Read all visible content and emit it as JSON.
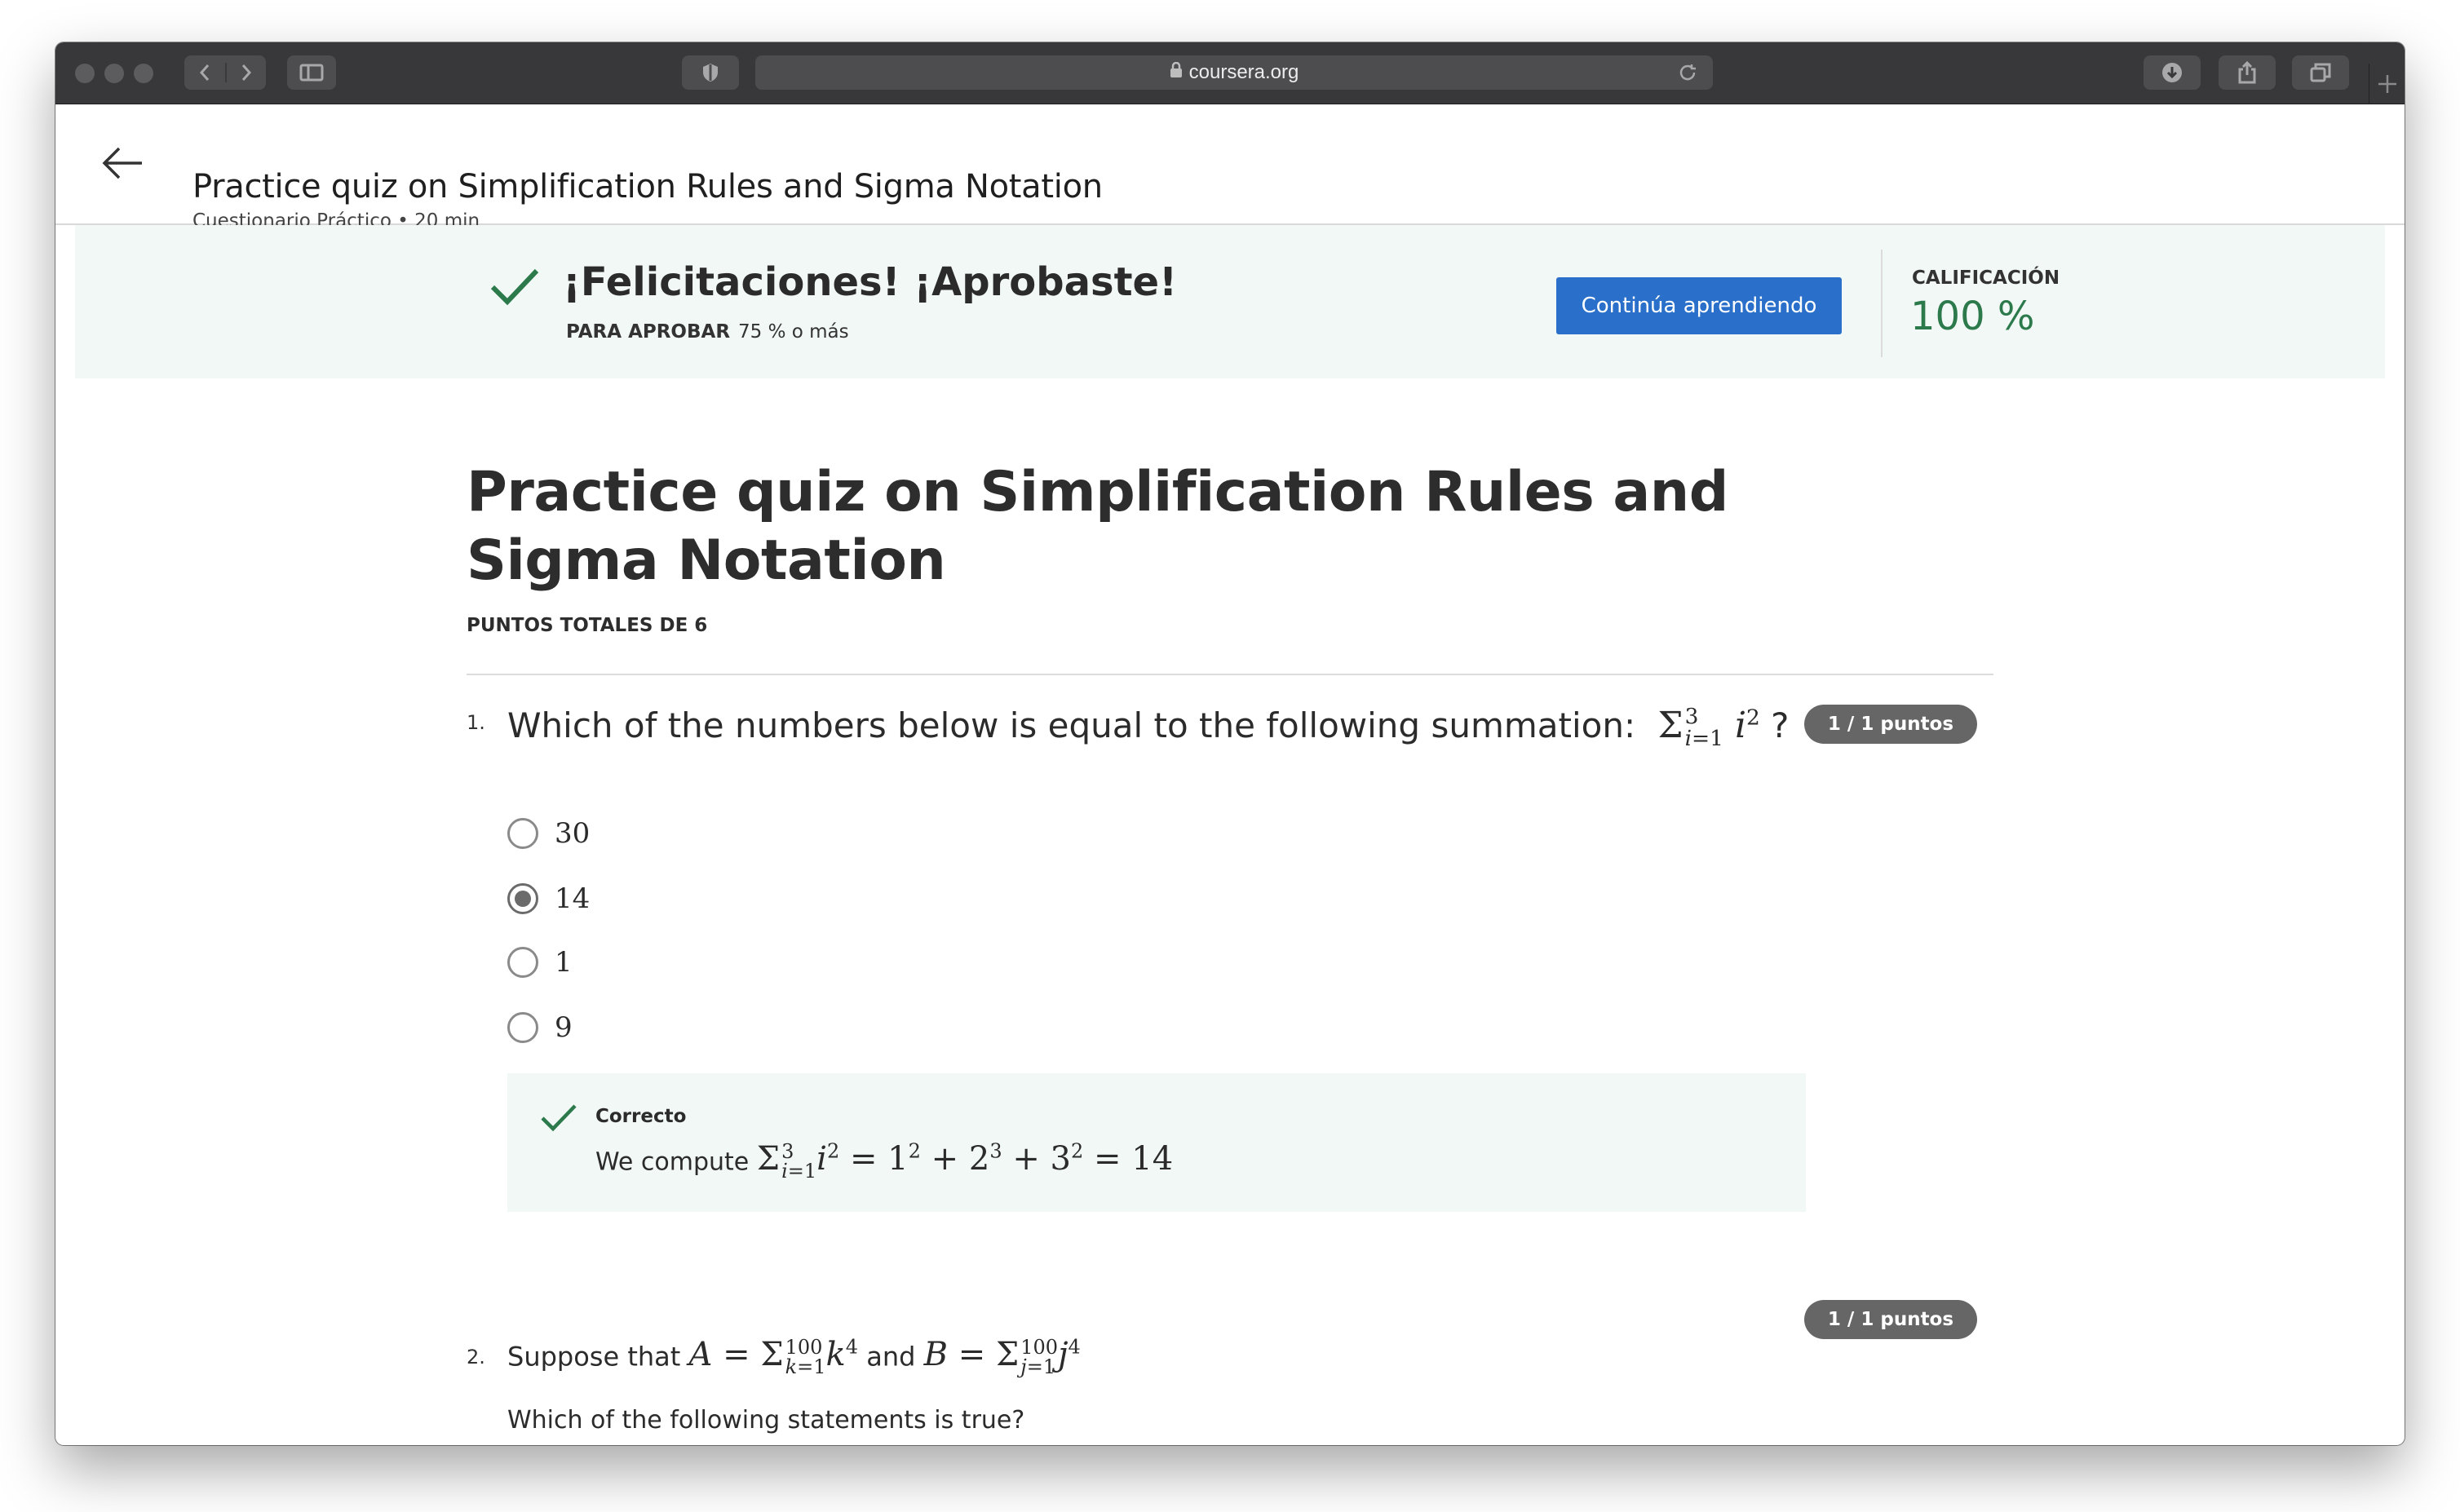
{
  "browser": {
    "url": "coursera.org"
  },
  "header": {
    "title": "Practice quiz on Simplification Rules and Sigma Notation",
    "subtitle": "Cuestionario Práctico • 20 min"
  },
  "banner": {
    "message": "¡Felicitaciones! ¡Aprobaste!",
    "pass_label": "PARA APROBAR",
    "pass_value": "75 % o más",
    "continue_label": "Continúa aprendiendo",
    "grade_label": "CALIFICACIÓN",
    "grade_value": "100 %",
    "accent_color": "#2c7a4c",
    "button_color": "#2a6fc9"
  },
  "quiz": {
    "title": "Practice quiz on Simplification Rules and Sigma Notation",
    "total_points": "PUNTOS TOTALES DE 6",
    "questions": [
      {
        "number": "1.",
        "text_prefix": "Which of the numbers below is equal to the following summation:",
        "text_suffix": "?",
        "points": "1 / 1 puntos",
        "options": [
          "30",
          "14",
          "1",
          "9"
        ],
        "selected_index": 1,
        "feedback": {
          "title": "Correcto",
          "text_prefix": "We compute"
        }
      },
      {
        "number": "2.",
        "text_prefix": "Suppose that",
        "text_and": "and",
        "points": "1 / 1 puntos",
        "followup": "Which of the following statements is true?"
      }
    ]
  }
}
